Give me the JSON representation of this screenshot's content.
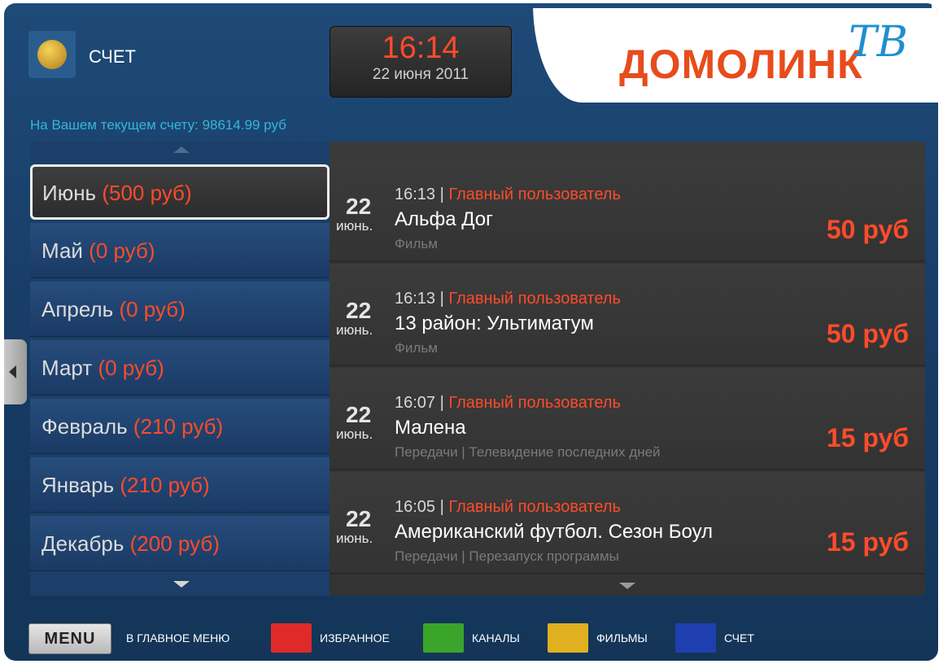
{
  "header": {
    "account_title": "СЧЕТ",
    "time": "16:14",
    "date": "22 июня 2011",
    "logo_text": "ДОМОЛИНК",
    "logo_suffix": "ТВ"
  },
  "balance_text": "На Вашем текущем счету: 98614.99 руб",
  "months": [
    {
      "name": "Июнь",
      "amount": "(500 руб)",
      "selected": true
    },
    {
      "name": "Май",
      "amount": "(0 руб)"
    },
    {
      "name": "Апрель",
      "amount": "(0 руб)"
    },
    {
      "name": "Март",
      "amount": "(0 руб)"
    },
    {
      "name": "Февраль",
      "amount": "(210 руб)"
    },
    {
      "name": "Январь",
      "amount": "(210 руб)"
    },
    {
      "name": "Декабрь",
      "amount": "(200 руб)"
    }
  ],
  "transactions": [
    {
      "day": "22",
      "month": "июнь.",
      "time": "16:13",
      "separator": " | ",
      "user": "Главный пользователь",
      "title": "Альфа Дог",
      "subtitle": "Фильм",
      "price": "50 руб"
    },
    {
      "day": "22",
      "month": "июнь.",
      "time": "16:13",
      "separator": " | ",
      "user": "Главный пользователь",
      "title": "13 район: Ультиматум",
      "subtitle": "Фильм",
      "price": "50 руб"
    },
    {
      "day": "22",
      "month": "июнь.",
      "time": "16:07",
      "separator": " | ",
      "user": "Главный пользователь",
      "title": "Малена",
      "subtitle": "Передачи | Телевидение последних дней",
      "price": "15 руб"
    },
    {
      "day": "22",
      "month": "июнь.",
      "time": "16:05",
      "separator": " | ",
      "user": "Главный пользователь",
      "title": "Американский футбол. Сезон Боул",
      "subtitle": "Передачи | Перезапуск программы",
      "price": "15 руб"
    }
  ],
  "footer": {
    "menu_button": "MENU",
    "main_menu_label": "В ГЛАВНОЕ МЕНЮ",
    "favorites_label": "ИЗБРАННОЕ",
    "channels_label": "КАНАЛЫ",
    "movies_label": "ФИЛЬМЫ",
    "account_label": "СЧЕТ"
  },
  "colors": {
    "red_key": "#e02a2a",
    "green_key": "#3aa52a",
    "yellow_key": "#e0b020",
    "blue_key": "#1f3fb0",
    "accent": "#ff4b2a",
    "balance_text": "#35b6d8"
  },
  "icons": {
    "account": "coins-bag-icon",
    "scroll_up": "arrow-up-icon",
    "scroll_down": "arrow-down-icon",
    "side_tab": "chevron-left-icon"
  }
}
